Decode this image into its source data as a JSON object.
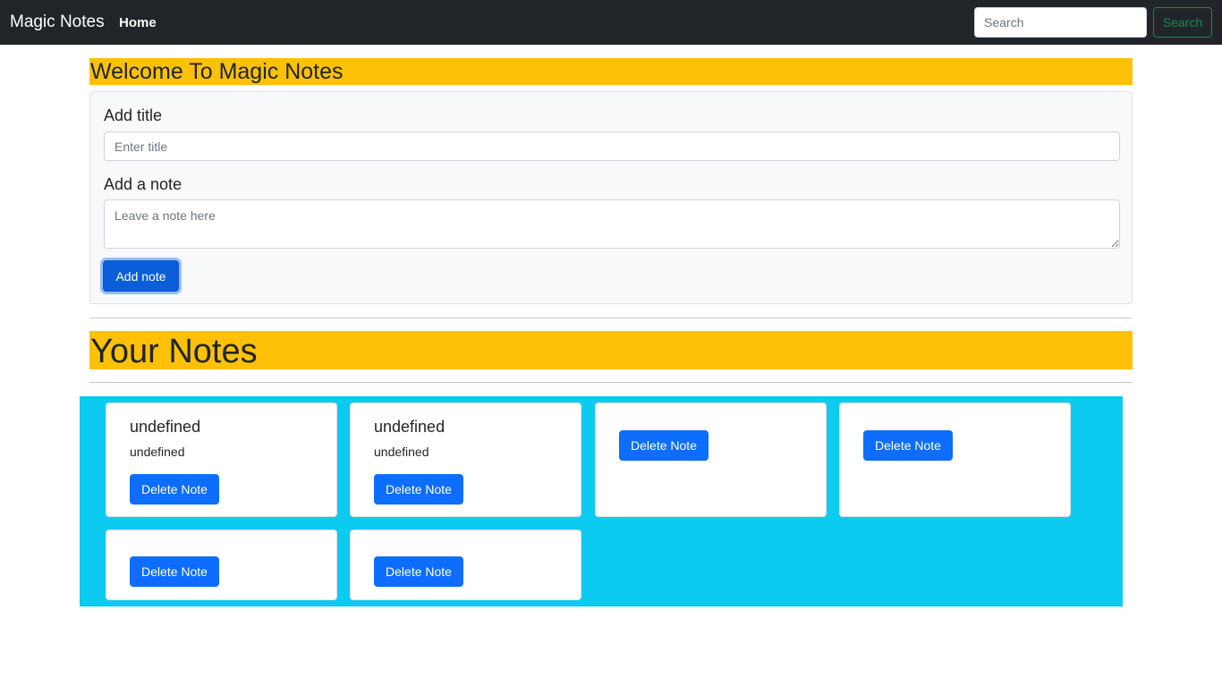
{
  "navbar": {
    "brand": "Magic Notes",
    "home_link": "Home",
    "search_placeholder": "Search",
    "search_button": "Search"
  },
  "welcome_heading": "Welcome To Magic Notes",
  "form": {
    "title_label": "Add title",
    "title_placeholder": "Enter title",
    "note_label": "Add a note",
    "note_placeholder": "Leave a note here",
    "add_button": "Add note"
  },
  "notes_heading": "Your Notes",
  "notes": [
    {
      "title": "undefined",
      "text": "undefined",
      "delete_label": "Delete Note"
    },
    {
      "title": "undefined",
      "text": "undefined",
      "delete_label": "Delete Note"
    },
    {
      "title": "",
      "text": "",
      "delete_label": "Delete Note"
    },
    {
      "title": "",
      "text": "",
      "delete_label": "Delete Note"
    },
    {
      "title": "",
      "text": "",
      "delete_label": "Delete Note"
    },
    {
      "title": "",
      "text": "",
      "delete_label": "Delete Note"
    }
  ],
  "colors": {
    "navbar_bg": "#212529",
    "heading_bg": "#ffc107",
    "notes_bg": "#0dcaf0",
    "primary": "#0d6efd",
    "success": "#198754"
  }
}
